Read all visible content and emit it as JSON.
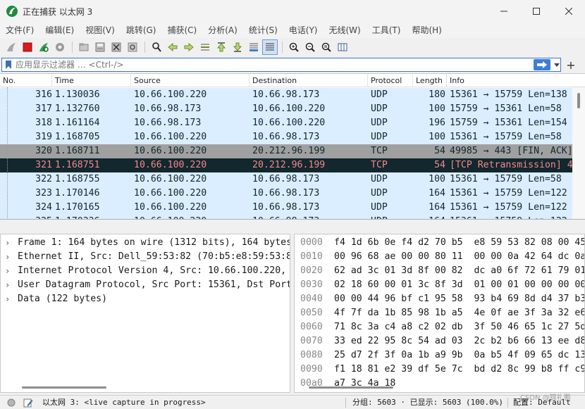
{
  "window": {
    "title": "正在捕获 以太网 3",
    "brand_color": "#1f8a3c"
  },
  "menu": [
    "文件(F)",
    "编辑(E)",
    "视图(V)",
    "跳转(G)",
    "捕获(C)",
    "分析(A)",
    "统计(S)",
    "电话(Y)",
    "无线(W)",
    "工具(T)",
    "帮助(H)"
  ],
  "toolbar": {
    "icons": [
      "shark-fin-start-icon",
      "stop-square-icon",
      "restart-fin-icon",
      "capture-options-icon",
      "open-folder-icon",
      "save-file-icon",
      "close-file-icon",
      "reload-icon",
      "find-magnifier-icon",
      "go-back-arrow-icon",
      "go-forward-arrow-icon",
      "go-to-packet-icon",
      "go-first-icon",
      "go-last-icon",
      "autoscroll-icon",
      "colorize-lines-icon",
      "zoom-in-icon",
      "zoom-out-icon",
      "zoom-reset-icon",
      "resize-columns-icon"
    ]
  },
  "filter": {
    "placeholder": "应用显示过滤器 … <Ctrl-/>",
    "add_label": "+"
  },
  "packet_list": {
    "columns": [
      "No.",
      "Time",
      "Source",
      "Destination",
      "Protocol",
      "Length",
      "Info"
    ],
    "rows": [
      {
        "no": "316",
        "time": "1.130036",
        "src": "10.66.100.220",
        "dst": "10.66.98.173",
        "proto": "UDP",
        "len": "180",
        "info": "15361 → 15759 Len=138",
        "kind": "udp"
      },
      {
        "no": "317",
        "time": "1.132760",
        "src": "10.66.98.173",
        "dst": "10.66.100.220",
        "proto": "UDP",
        "len": "100",
        "info": "15759 → 15361 Len=58",
        "kind": "udp"
      },
      {
        "no": "318",
        "time": "1.161164",
        "src": "10.66.98.173",
        "dst": "10.66.100.220",
        "proto": "UDP",
        "len": "196",
        "info": "15759 → 15361 Len=154",
        "kind": "udp"
      },
      {
        "no": "319",
        "time": "1.168705",
        "src": "10.66.100.220",
        "dst": "10.66.98.173",
        "proto": "UDP",
        "len": "100",
        "info": "15361 → 15759 Len=58",
        "kind": "udp"
      },
      {
        "no": "320",
        "time": "1.168711",
        "src": "10.66.100.220",
        "dst": "20.212.96.199",
        "proto": "TCP",
        "len": "54",
        "info": "49985 → 443 [FIN, ACK]",
        "kind": "fin"
      },
      {
        "no": "321",
        "time": "1.168751",
        "src": "10.66.100.220",
        "dst": "20.212.96.199",
        "proto": "TCP",
        "len": "54",
        "info": "[TCP Retransmission] 4",
        "kind": "retrans"
      },
      {
        "no": "322",
        "time": "1.168755",
        "src": "10.66.100.220",
        "dst": "10.66.98.173",
        "proto": "UDP",
        "len": "100",
        "info": "15361 → 15759 Len=58",
        "kind": "udp"
      },
      {
        "no": "323",
        "time": "1.170146",
        "src": "10.66.100.220",
        "dst": "10.66.98.173",
        "proto": "UDP",
        "len": "164",
        "info": "15361 → 15759 Len=122",
        "kind": "udp"
      },
      {
        "no": "324",
        "time": "1.170165",
        "src": "10.66.100.220",
        "dst": "10.66.98.173",
        "proto": "UDP",
        "len": "164",
        "info": "15361 → 15759 Len=122",
        "kind": "udp"
      },
      {
        "no": "325",
        "time": "1.170336",
        "src": "10.66.100.220",
        "dst": "10.66.98.173",
        "proto": "UDP",
        "len": "164",
        "info": "15361 → 15759 Len=122",
        "kind": "udp"
      }
    ]
  },
  "details": [
    "Frame 1: 164 bytes on wire (1312 bits), 164 bytes",
    "Ethernet II, Src: Dell_59:53:82 (70:b5:e8:59:53:8",
    "Internet Protocol Version 4, Src: 10.66.100.220,",
    "User Datagram Protocol, Src Port: 15361, Dst Port",
    "Data (122 bytes)"
  ],
  "bytes": [
    {
      "off": "0000",
      "hex": "f4 1d 6b 0e f4 d2 70 b5  e8 59 53 82 08 00 45"
    },
    {
      "off": "0010",
      "hex": "00 96 68 ae 00 00 80 11  00 00 0a 42 64 dc 0a"
    },
    {
      "off": "0020",
      "hex": "62 ad 3c 01 3d 8f 00 82  dc a0 6f 72 61 79 01"
    },
    {
      "off": "0030",
      "hex": "02 18 60 00 01 3c 8f 3d  01 00 01 00 00 00 00"
    },
    {
      "off": "0040",
      "hex": "00 00 44 96 bf c1 95 58  93 b4 69 8d d4 37 b3"
    },
    {
      "off": "0050",
      "hex": "4f 7f da 1b 85 98 1b a5  4e 0f ae 3f 3a 32 e6"
    },
    {
      "off": "0060",
      "hex": "71 8c 3a c4 a8 c2 02 db  3f 50 46 65 1c 27 5d"
    },
    {
      "off": "0070",
      "hex": "33 ed 22 95 8c 54 ad 03  2c b2 b6 66 13 ee d8"
    },
    {
      "off": "0080",
      "hex": "25 d7 2f 3f 0a 1b a9 9b  0a b5 4f 09 65 dc 13"
    },
    {
      "off": "0090",
      "hex": "f1 18 81 e2 39 df 5e 7c  bd d2 8c 99 b8 ff c9"
    },
    {
      "off": "00a0",
      "hex": "a7 3c 4a 18"
    }
  ],
  "status": {
    "interface": "以太网 3: <live capture in progress>",
    "packets": "分组: 5603 · 已显示: 5603 (100.0%)",
    "profile": "配置: Default",
    "watermark": "CSDN @锦礼鹏"
  }
}
